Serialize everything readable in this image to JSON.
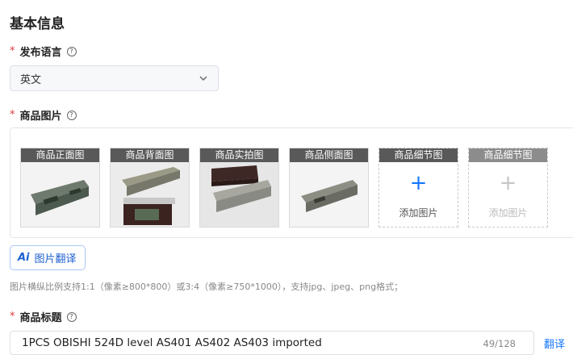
{
  "section": {
    "title": "基本信息"
  },
  "language": {
    "label": "发布语言",
    "required_mark": "*",
    "help": "?",
    "value": "英文"
  },
  "images": {
    "label": "商品图片",
    "required_mark": "*",
    "help": "?",
    "slots": [
      {
        "caption": "商品正面图",
        "state": "filled"
      },
      {
        "caption": "商品背面图",
        "state": "filled"
      },
      {
        "caption": "商品实拍图",
        "state": "filled"
      },
      {
        "caption": "商品侧面图",
        "state": "filled"
      },
      {
        "caption": "商品细节图",
        "state": "empty",
        "add_text": "添加图片"
      },
      {
        "caption": "商品细节图",
        "state": "disabled",
        "add_text": "添加图片"
      }
    ],
    "translate_button": {
      "ai": "Ai",
      "label": "图片翻译"
    },
    "hint": "图片横纵比例支持1:1（像素≥800*800）或3:4（像素≥750*1000），支持jpg、jpeg、png格式；"
  },
  "product_title": {
    "label": "商品标题",
    "required_mark": "*",
    "help": "?",
    "value": "1PCS OBISHI 524D level AS401 AS402 AS403 imported",
    "count": "49/128",
    "translate_link": "翻译"
  },
  "colors": {
    "accent": "#1677ff",
    "required": "#e4393c",
    "caption_bg": "#595959"
  }
}
